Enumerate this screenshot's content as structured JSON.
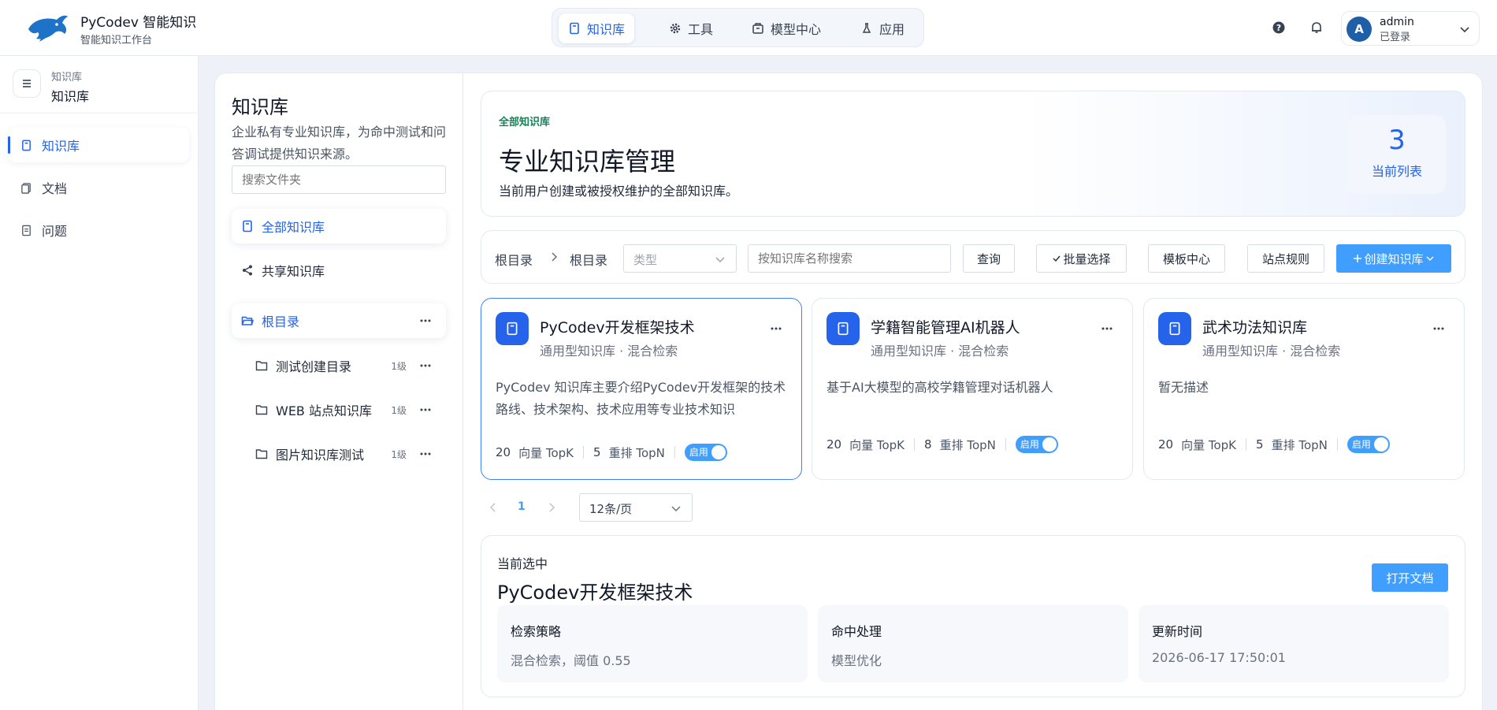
{
  "app": {
    "title": "PyCodev 智能知识",
    "subtitle": "智能知识工作台"
  },
  "nav": {
    "items": [
      {
        "label": "知识库",
        "icon": "book-icon",
        "active": true
      },
      {
        "label": "工具",
        "icon": "gear-icon",
        "active": false
      },
      {
        "label": "模型中心",
        "icon": "box-icon",
        "active": false
      },
      {
        "label": "应用",
        "icon": "flask-icon",
        "active": false
      }
    ]
  },
  "user": {
    "initial": "A",
    "name": "admin",
    "status": "已登录"
  },
  "sidebar": {
    "breadcrumb_small": "知识库",
    "breadcrumb_main": "知识库",
    "items": [
      {
        "label": "知识库",
        "icon": "book-icon",
        "active": true
      },
      {
        "label": "文档",
        "icon": "document-icon",
        "active": false
      },
      {
        "label": "问题",
        "icon": "question-doc-icon",
        "active": false
      }
    ]
  },
  "folder_panel": {
    "title": "知识库",
    "description": "企业私有专业知识库，为命中测试和问答调试提供知识来源。",
    "search_placeholder": "搜索文件夹",
    "all_label": "全部知识库",
    "shared_label": "共享知识库",
    "root_label": "根目录",
    "folders": [
      {
        "name": "测试创建目录",
        "level": "1级"
      },
      {
        "name": "WEB 站点知识库",
        "level": "1级"
      },
      {
        "name": "图片知识库测试",
        "level": "1级"
      }
    ]
  },
  "hero": {
    "tag": "全部知识库",
    "title": "专业知识库管理",
    "description": "当前用户创建或被授权维护的全部知识库。",
    "count": "3",
    "count_label": "当前列表"
  },
  "toolbar": {
    "crumb_root": "根目录",
    "crumb_current": "根目录",
    "type_placeholder": "类型",
    "search_placeholder": "按知识库名称搜索",
    "query": "查询",
    "batch_select": "批量选择",
    "template_center": "模板中心",
    "site_rules": "站点规则",
    "create": "创建知识库"
  },
  "cards": [
    {
      "title": "PyCodev开发框架技术",
      "subtitle": "通用型知识库 · 混合检索",
      "description": "PyCodev 知识库主要介绍PyCodev开发框架的技术路线、技术架构、技术应用等专业技术知识",
      "topk": "20",
      "topk_label": "向量 TopK",
      "topn": "5",
      "topn_label": "重排 TopN",
      "toggle": "启用",
      "selected": true
    },
    {
      "title": "学籍智能管理AI机器人",
      "subtitle": "通用型知识库 · 混合检索",
      "description": "基于AI大模型的高校学籍管理对话机器人",
      "topk": "20",
      "topk_label": "向量 TopK",
      "topn": "8",
      "topn_label": "重排 TopN",
      "toggle": "启用",
      "selected": false
    },
    {
      "title": "武术功法知识库",
      "subtitle": "通用型知识库 · 混合检索",
      "description": "暂无描述",
      "topk": "20",
      "topk_label": "向量 TopK",
      "topn": "5",
      "topn_label": "重排 TopN",
      "toggle": "启用",
      "selected": false
    }
  ],
  "pagination": {
    "page": "1",
    "page_size": "12条/页"
  },
  "detail": {
    "label": "当前选中",
    "title": "PyCodev开发框架技术",
    "open_button": "打开文档",
    "info": [
      {
        "label": "检索策略",
        "value": "混合检索，阈值 0.55"
      },
      {
        "label": "命中处理",
        "value": "模型优化"
      },
      {
        "label": "更新时间",
        "value": "2026-06-17 17:50:01"
      }
    ]
  },
  "colors": {
    "primary": "#2563eb",
    "button": "#409eff",
    "tag_green": "#16805a"
  }
}
